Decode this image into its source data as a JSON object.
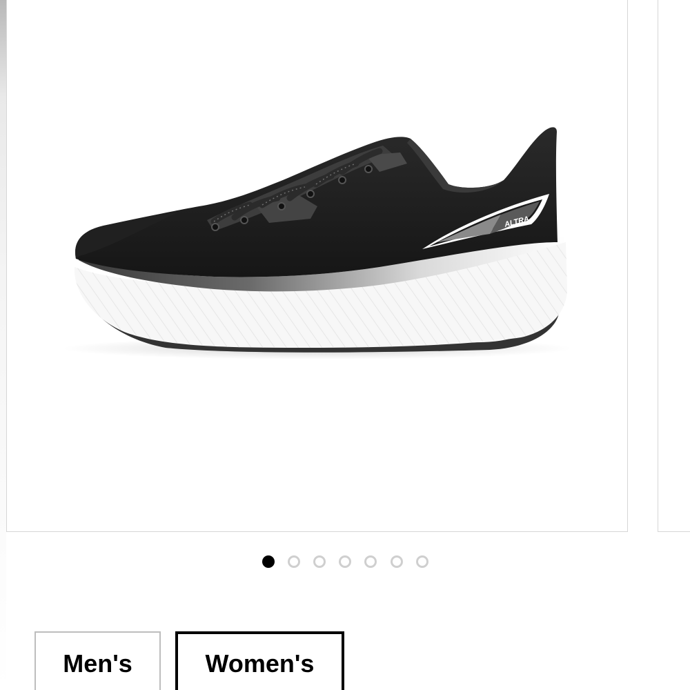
{
  "product": {
    "image_alt": "Black and white running shoe, side view",
    "logo_text": "ALTRA"
  },
  "carousel": {
    "total_slides": 7,
    "active_index": 0
  },
  "gender_options": [
    {
      "label": "Men's",
      "selected": false
    },
    {
      "label": "Women's",
      "selected": true
    }
  ],
  "colors": {
    "active_dot": "#000000",
    "inactive_dot_ring": "#cfcfcf",
    "selected_border": "#000000",
    "unselected_border": "#bdbdbd"
  }
}
